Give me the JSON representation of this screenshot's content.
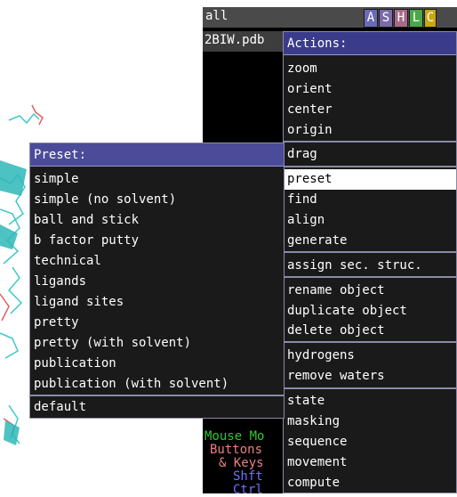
{
  "object_panel": {
    "all_label": "all",
    "buttons": [
      {
        "label": "A",
        "bg": "#6a6ab8"
      },
      {
        "label": "S",
        "bg": "#7b6ba8"
      },
      {
        "label": "H",
        "bg": "#a86a8a"
      },
      {
        "label": "L",
        "bg": "#4aa84a"
      },
      {
        "label": "C",
        "bg": "#c8a810"
      }
    ],
    "object_name": "2BIW.pdb"
  },
  "mouse_help": {
    "line1": "Mouse Mo",
    "line2": "Buttons",
    "line3": "& Keys",
    "line4": "Shft",
    "line5": "Ctrl",
    "colors": {
      "line1": "#30c830",
      "line2": "#e88080",
      "line3": "#e88080",
      "line4": "#7070ff",
      "line5": "#7070ff"
    }
  },
  "actions_menu": {
    "title": "Actions:",
    "items": [
      "zoom",
      "orient",
      "center",
      "origin",
      "drag",
      "preset",
      "find",
      "align",
      "generate",
      "assign sec. struc.",
      "rename object",
      "duplicate object",
      "delete object",
      "hydrogens",
      "remove waters",
      "state",
      "masking",
      "sequence",
      "movement",
      "compute"
    ],
    "selected": "preset"
  },
  "preset_menu": {
    "title": "Preset:",
    "items": [
      "simple",
      "simple (no solvent)",
      "ball and stick",
      "b factor putty",
      "technical",
      "ligands",
      "ligand sites",
      "pretty",
      "pretty (with solvent)",
      "publication",
      "publication (with solvent)"
    ],
    "default_item": "default"
  },
  "colors": {
    "menu_title_bg": "#3b3b8c",
    "menu_bg": "#1a1a1a",
    "selected_bg": "#ffffff",
    "molecule_cyan": "#40d0d0"
  }
}
